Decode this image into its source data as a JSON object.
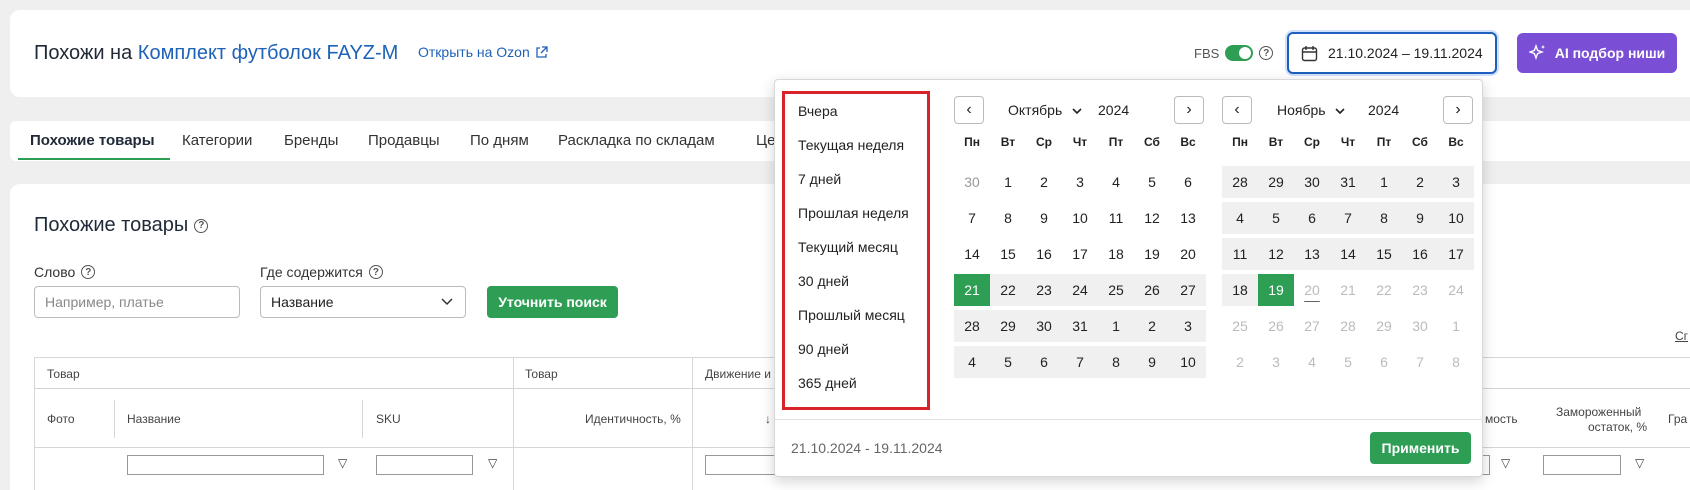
{
  "header": {
    "title_prefix": "Похожи на",
    "product_name": "Комплект футболок FAYZ-M",
    "ozon_link": "Открыть на Ozon",
    "fbs_label": "FBS",
    "fbs_enabled": true,
    "date_range": "21.10.2024 – 19.11.2024",
    "ai_button": "AI подбор ниши"
  },
  "tabs": [
    "Похожие товары",
    "Категории",
    "Бренды",
    "Продавцы",
    "По дням",
    "Раскладка по складам",
    "Це"
  ],
  "section": {
    "title": "Похожие товары",
    "word_label": "Слово",
    "word_placeholder": "Например, платье",
    "where_label": "Где содержится",
    "where_value": "Название",
    "refine_button": "Уточнить поиск"
  },
  "table": {
    "group_headers": [
      "Товар",
      "Товар",
      "Движение и"
    ],
    "columns": [
      "Фото",
      "Название",
      "SKU",
      "Идентичность, %",
      "↓",
      "мость",
      "Замороженный",
      "остаток, %",
      "Гра"
    ],
    "right_edge_label": "Сг"
  },
  "datepicker": {
    "presets": [
      "Вчера",
      "Текущая неделя",
      "7 дней",
      "Прошлая неделя",
      "Текущий месяц",
      "30 дней",
      "Прошлый месяц",
      "90 дней",
      "365 дней"
    ],
    "weekdays": [
      "Пн",
      "Вт",
      "Ср",
      "Чт",
      "Пт",
      "Сб",
      "Вс"
    ],
    "left_month": {
      "month": "Октябрь",
      "year": "2024",
      "weeks": [
        [
          "30",
          "1",
          "2",
          "3",
          "4",
          "5",
          "6"
        ],
        [
          "7",
          "8",
          "9",
          "10",
          "11",
          "12",
          "13"
        ],
        [
          "14",
          "15",
          "16",
          "17",
          "18",
          "19",
          "20"
        ],
        [
          "21",
          "22",
          "23",
          "24",
          "25",
          "26",
          "27"
        ],
        [
          "28",
          "29",
          "30",
          "31",
          "1",
          "2",
          "3"
        ],
        [
          "4",
          "5",
          "6",
          "7",
          "8",
          "9",
          "10"
        ]
      ]
    },
    "right_month": {
      "month": "Ноябрь",
      "year": "2024",
      "weeks": [
        [
          "28",
          "29",
          "30",
          "31",
          "1",
          "2",
          "3"
        ],
        [
          "4",
          "5",
          "6",
          "7",
          "8",
          "9",
          "10"
        ],
        [
          "11",
          "12",
          "13",
          "14",
          "15",
          "16",
          "17"
        ],
        [
          "18",
          "19",
          "20",
          "21",
          "22",
          "23",
          "24"
        ],
        [
          "25",
          "26",
          "27",
          "28",
          "29",
          "30",
          "1"
        ],
        [
          "2",
          "3",
          "4",
          "5",
          "6",
          "7",
          "8"
        ]
      ]
    },
    "selected_start": "21",
    "selected_end": "19",
    "footer_range": "21.10.2024 - 19.11.2024",
    "apply_button": "Применить",
    "colors": {
      "accent": "#2e9e55",
      "highlight_border": "#d8232a",
      "link": "#1e62b8",
      "ai": "#7a4fd6"
    }
  }
}
